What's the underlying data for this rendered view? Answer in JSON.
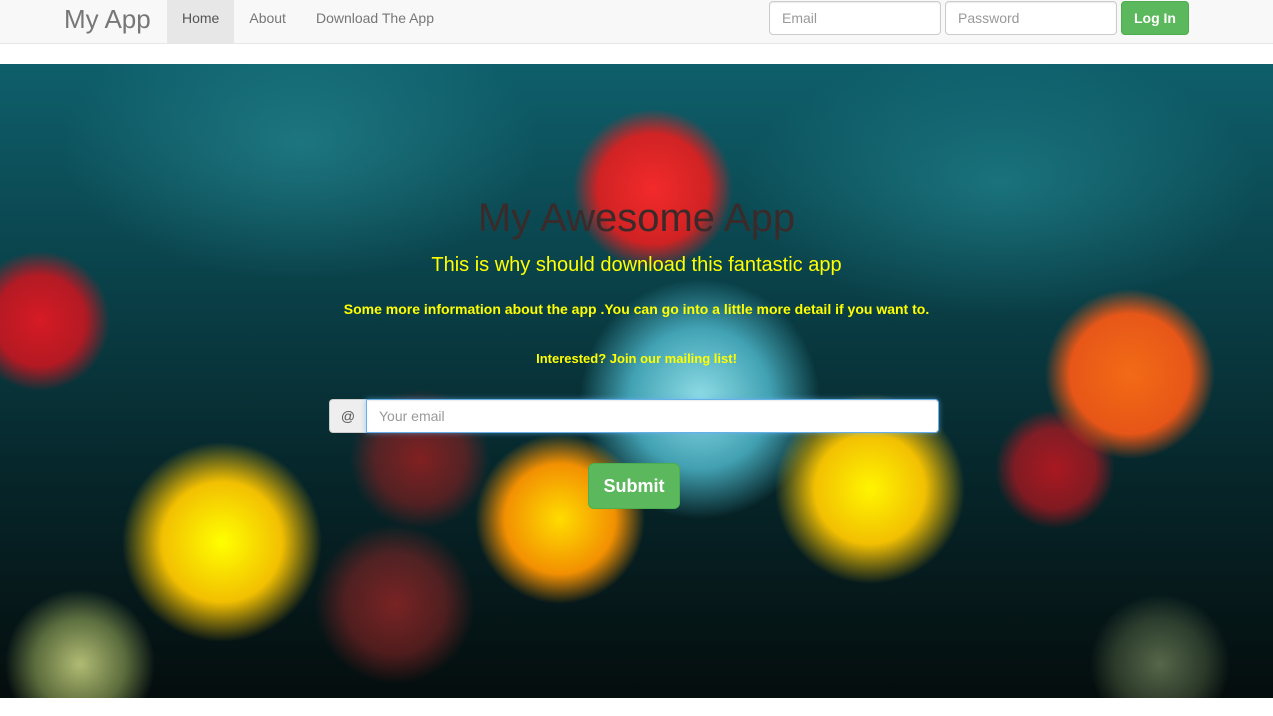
{
  "navbar": {
    "brand": "My App",
    "links": [
      {
        "label": "Home",
        "active": true
      },
      {
        "label": "About",
        "active": false
      },
      {
        "label": "Download The App",
        "active": false
      }
    ],
    "login": {
      "email_placeholder": "Email",
      "password_placeholder": "Password",
      "button_label": "Log In"
    }
  },
  "hero": {
    "title": "My Awesome App",
    "subtitle": "This is why should download this fantastic app",
    "info": "Some more information about the app .You can go into a little more detail if you want to.",
    "interest": "Interested? Join our mailing list!",
    "email_addon": "@",
    "email_placeholder": "Your email",
    "submit_label": "Submit"
  },
  "colors": {
    "accent_green": "#5cb85c",
    "text_yellow": "#ffff00",
    "navbar_bg": "#f8f8f8"
  }
}
